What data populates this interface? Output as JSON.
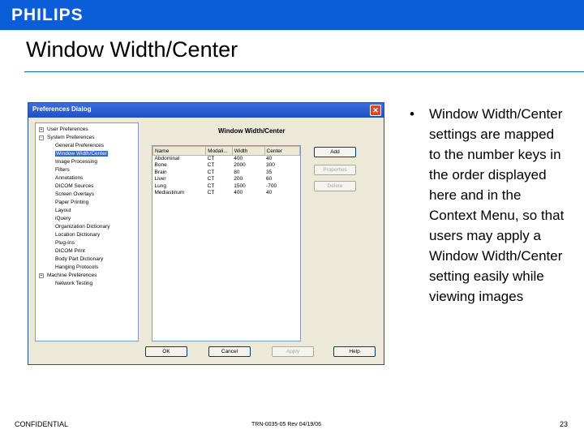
{
  "header": {
    "logo": "PHILIPS",
    "title": "Window Width/Center"
  },
  "colors": {
    "accent": "#0b5ed7",
    "dialog_bg": "#ece9d8",
    "selection": "#316ac5"
  },
  "dialog": {
    "title": "Preferences Dialog",
    "close_icon": "close-icon",
    "tree": [
      {
        "label": "User Preferences",
        "expander": "+"
      },
      {
        "label": "System Preferences",
        "expander": "-"
      },
      {
        "label": "General Preferences"
      },
      {
        "label": "Window Width/Center",
        "selected": true
      },
      {
        "label": "Image Processing"
      },
      {
        "label": "Filters"
      },
      {
        "label": "Annotations"
      },
      {
        "label": "DICOM Sources"
      },
      {
        "label": "Screen Overlays"
      },
      {
        "label": "Paper Printing"
      },
      {
        "label": "Layout"
      },
      {
        "label": "iQuery"
      },
      {
        "label": "Organization Dictionary"
      },
      {
        "label": "Location Dictionary"
      },
      {
        "label": "Plug-Ins"
      },
      {
        "label": "DICOM Print"
      },
      {
        "label": "Body Part Dictionary"
      },
      {
        "label": "Hanging Protocols"
      },
      {
        "label": "Machine Preferences",
        "expander": "+"
      },
      {
        "label": "Network Testing"
      }
    ],
    "pane_title": "Window Width/Center",
    "columns": [
      "Name",
      "Modali...",
      "Width",
      "Center"
    ],
    "rows": [
      [
        "Abdominal",
        "CT",
        "400",
        "40"
      ],
      [
        "Bone",
        "CT",
        "2000",
        "300"
      ],
      [
        "Brain",
        "CT",
        "80",
        "35"
      ],
      [
        "Liver",
        "CT",
        "200",
        "60"
      ],
      [
        "Lung",
        "CT",
        "1500",
        "-700"
      ],
      [
        "Mediastinum",
        "CT",
        "400",
        "40"
      ]
    ],
    "buttons": {
      "add": "Add",
      "properties": "Properties",
      "delete": "Delete",
      "ok": "OK",
      "cancel": "Cancel",
      "apply": "Apply",
      "help": "Help"
    }
  },
  "bullet": "Window Width/Center settings are mapped to the number keys in the order displayed here and in the Context Menu, so that users may apply a Window Width/Center setting easily while viewing images",
  "footer": {
    "left": "CONFIDENTIAL",
    "center": "TRN-0035-05 Rev 04/19/06",
    "page": "23"
  }
}
